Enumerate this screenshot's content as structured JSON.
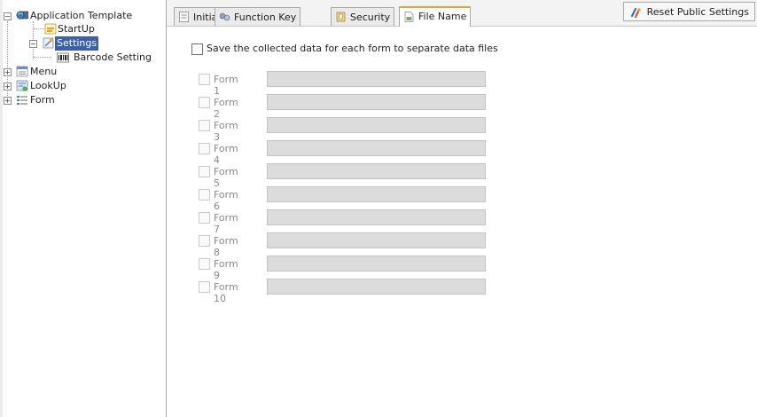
{
  "tree": {
    "root": "Application Template",
    "children": [
      "StartUp",
      "Settings",
      "Barcode Setting",
      "Menu",
      "LookUp",
      "Form"
    ],
    "selected": "Settings"
  },
  "tabs": [
    "Initial",
    "Function Key",
    "Security",
    "File Name"
  ],
  "active_tab": "File Name",
  "reset_button": "Reset Public Settings",
  "main_checkbox": "Save the collected data for each form to separate data files",
  "forms": [
    "Form 1",
    "Form 2",
    "Form 3",
    "Form 4",
    "Form 5",
    "Form 6",
    "Form 7",
    "Form 8",
    "Form 9",
    "Form 10"
  ],
  "colors": {
    "selection": "#3c5fa8",
    "active_tab_accent": "#e8a23a",
    "disabled_field": "#dcdcdc"
  }
}
